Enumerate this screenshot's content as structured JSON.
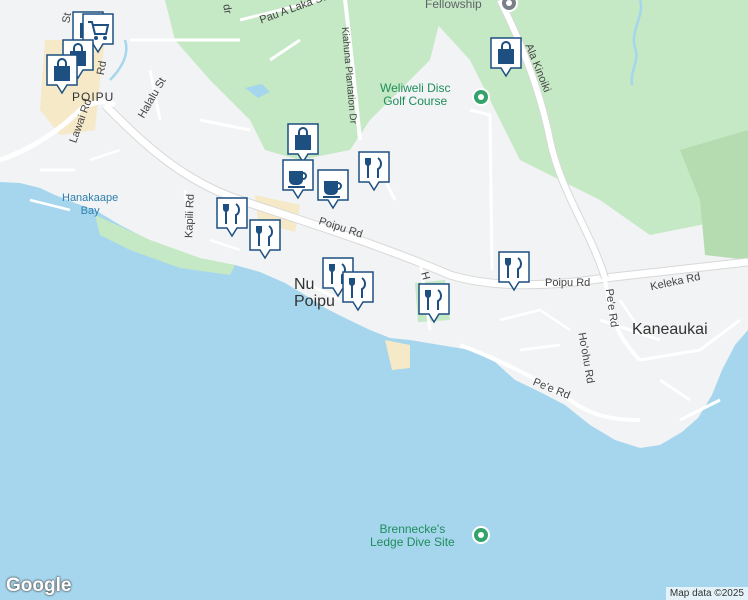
{
  "map": {
    "places": [
      {
        "key": "poipu_town",
        "label": "POIPU"
      },
      {
        "key": "kaneaukai",
        "label": "Kaneaukai"
      },
      {
        "key": "nu_poipu",
        "label": "Nu Poipu"
      }
    ],
    "water_labels": [
      {
        "key": "hanakaape",
        "label": "Hanakaape\nBay"
      }
    ],
    "pois": [
      {
        "key": "weliweli",
        "label": "Weliweli Disc\nGolf Course"
      },
      {
        "key": "brennecke",
        "label": "Brennecke's\nLedge Dive Site"
      },
      {
        "key": "fellowship",
        "label": "Fellowship"
      }
    ],
    "roads": [
      {
        "key": "poipu_rd_1",
        "label": "Poipu Rd"
      },
      {
        "key": "poipu_rd_2",
        "label": "Poipu Rd"
      },
      {
        "key": "keleka",
        "label": "Keleka Rd"
      },
      {
        "key": "pee",
        "label": "Pe'e Rd"
      },
      {
        "key": "pee2",
        "label": "Pe'e Rd"
      },
      {
        "key": "hoohu",
        "label": "Ho'ohu Rd"
      },
      {
        "key": "kiahuna",
        "label": "Kiahuna Plantation Dr"
      },
      {
        "key": "kapili",
        "label": "Kapili Rd"
      },
      {
        "key": "lawai",
        "label": "Lawai Rd"
      },
      {
        "key": "halalu",
        "label": "Halalu St"
      },
      {
        "key": "pau_a_laka",
        "label": "Pau A Laka St"
      },
      {
        "key": "ala_kinoiki",
        "label": "Ala Kinoiki"
      },
      {
        "key": "road_st",
        "label": "St"
      },
      {
        "key": "road_rd",
        "label": "Rd"
      },
      {
        "key": "road_dr",
        "label": "dr"
      },
      {
        "key": "road_h",
        "label": "H"
      }
    ],
    "markers": [
      {
        "key": "m1",
        "type": "shopping",
        "icon": "shopping-bag-icon"
      },
      {
        "key": "m2",
        "type": "grocery",
        "icon": "shopping-cart-icon"
      },
      {
        "key": "m3",
        "type": "shopping",
        "icon": "shopping-bag-icon"
      },
      {
        "key": "m4",
        "type": "shopping",
        "icon": "shopping-bag-icon"
      },
      {
        "key": "m5",
        "type": "shopping",
        "icon": "shopping-bag-icon"
      },
      {
        "key": "m6",
        "type": "shopping",
        "icon": "shopping-bag-icon"
      },
      {
        "key": "m7",
        "type": "cafe",
        "icon": "coffee-cup-icon"
      },
      {
        "key": "m8",
        "type": "cafe",
        "icon": "coffee-cup-icon"
      },
      {
        "key": "m9",
        "type": "restaurant",
        "icon": "fork-knife-icon"
      },
      {
        "key": "m10",
        "type": "restaurant",
        "icon": "fork-knife-icon"
      },
      {
        "key": "m11",
        "type": "restaurant",
        "icon": "fork-knife-icon"
      },
      {
        "key": "m12",
        "type": "restaurant",
        "icon": "fork-knife-icon"
      },
      {
        "key": "m13",
        "type": "restaurant",
        "icon": "fork-knife-icon"
      },
      {
        "key": "m14",
        "type": "restaurant",
        "icon": "fork-knife-icon"
      },
      {
        "key": "m15",
        "type": "restaurant",
        "icon": "fork-knife-icon"
      }
    ],
    "colors": {
      "ocean": "#a6d6ee",
      "land": "#f1f3f4",
      "park": "#c5e8c5",
      "beach": "#f5e9c8",
      "road": "#ffffff",
      "marker_fill": "#ffffff",
      "marker_icon": "#1d4f80",
      "poi_green": "#34a36b"
    }
  },
  "footer": {
    "logo": "Google",
    "attribution": "Map data ©2025"
  }
}
